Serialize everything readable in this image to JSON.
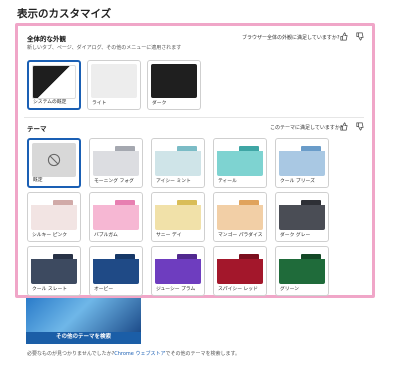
{
  "page_title": "表示のカスタマイズ",
  "overall": {
    "heading": "全体的な外観",
    "subtitle": "新しいタブ、ページ、ダイアログ、その他のメニューに適用されます",
    "feedback": "ブラウザー全体の外観に満足していますか?",
    "options": [
      {
        "label": "システムの既定",
        "selected": true
      },
      {
        "label": "ライト",
        "selected": false
      },
      {
        "label": "ダーク",
        "selected": false
      }
    ]
  },
  "theme": {
    "heading": "テーマ",
    "feedback": "このテーマに満足していますか?",
    "options": [
      {
        "label": "既定",
        "selected": true,
        "colors": [
          "#d8d8d8",
          "#c4c4c4"
        ]
      },
      {
        "label": "モーニング フォグ",
        "colors": [
          "#dcdde1",
          "#a5a8b0"
        ]
      },
      {
        "label": "アイシー ミント",
        "colors": [
          "#cfe4e8",
          "#7bbcc6"
        ]
      },
      {
        "label": "ティール",
        "colors": [
          "#7ed3d1",
          "#3fa6a5"
        ]
      },
      {
        "label": "クール ブリーズ",
        "colors": [
          "#a9c8e3",
          "#6a9cc9"
        ]
      },
      {
        "label": "シルキー ピンク",
        "colors": [
          "#f2e4e3",
          "#d1aaa8"
        ]
      },
      {
        "label": "バブルガム",
        "colors": [
          "#f6b7d3",
          "#e77fb1"
        ]
      },
      {
        "label": "サニー デイ",
        "colors": [
          "#f1e1a9",
          "#d9bd58"
        ]
      },
      {
        "label": "マンゴー パラダイス",
        "colors": [
          "#f2cfa6",
          "#e0a35c"
        ]
      },
      {
        "label": "ダーク グレー",
        "colors": [
          "#4a4d55",
          "#2e3036"
        ]
      },
      {
        "label": "クール スレート",
        "colors": [
          "#3d4a60",
          "#283246"
        ]
      },
      {
        "label": "オービー",
        "colors": [
          "#1f4a86",
          "#163867"
        ]
      },
      {
        "label": "ジューシー プラム",
        "colors": [
          "#6e3dbf",
          "#51298f"
        ]
      },
      {
        "label": "スパイシー レッド",
        "colors": [
          "#a3172b",
          "#7b0f1e"
        ]
      },
      {
        "label": "グリーン",
        "colors": [
          "#1f6b3a",
          "#134826"
        ]
      }
    ]
  },
  "search_card": {
    "label": "その他のテーマを検索"
  },
  "footer": {
    "before": "必要なものが見つかりませんでしたか?",
    "link": "Chrome ウェブストア",
    "after": "でその他のテーマを検索します。"
  },
  "colors": {
    "highlight": "#f0a6c8",
    "accent": "#1a5fb4"
  }
}
